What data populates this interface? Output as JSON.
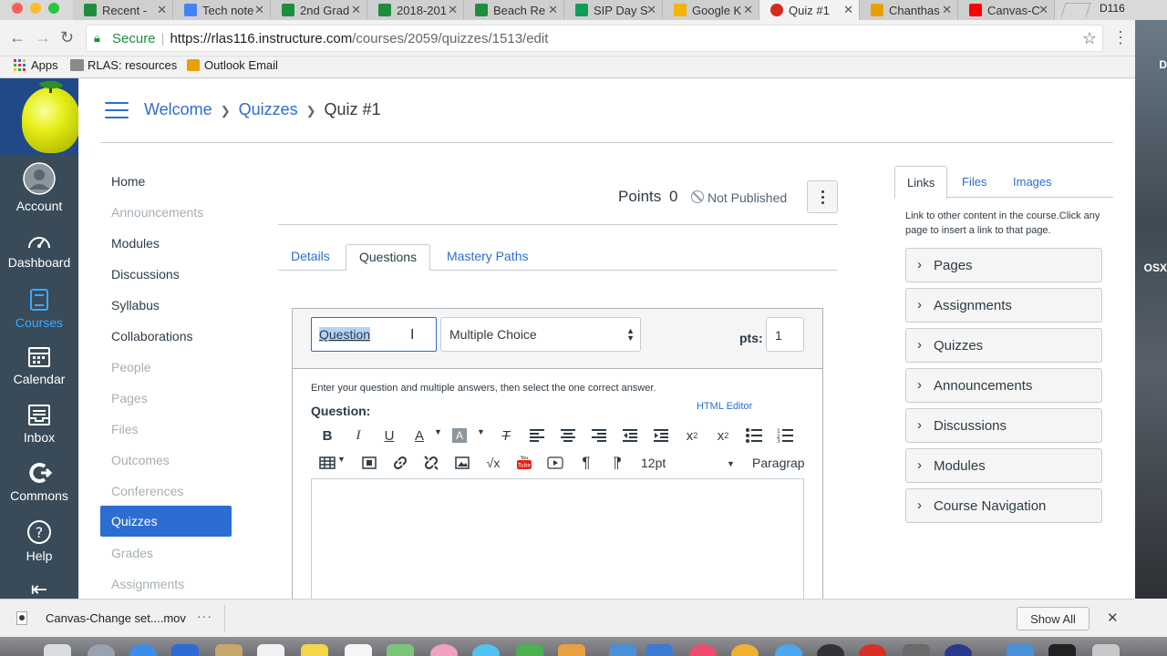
{
  "browser": {
    "tabs": [
      {
        "label": "Recent -",
        "favicon_color": "#1e8e3e",
        "icon": "drive-icon"
      },
      {
        "label": "Tech note",
        "favicon_color": "#4285f4",
        "icon": "docs-icon"
      },
      {
        "label": "2nd Grad",
        "favicon_color": "#1e8e3e",
        "icon": "drive-icon"
      },
      {
        "label": "2018-201",
        "favicon_color": "#1e8e3e",
        "icon": "drive-icon"
      },
      {
        "label": "Beach Re",
        "favicon_color": "#1e8e3e",
        "icon": "drive-icon"
      },
      {
        "label": "SIP Day S",
        "favicon_color": "#0f9d58",
        "icon": "sheets-icon"
      },
      {
        "label": "Google K",
        "favicon_color": "#f4b400",
        "icon": "keep-icon"
      },
      {
        "label": "Quiz #1",
        "favicon_color": "#d52b1e",
        "icon": "canvas-icon",
        "active": true
      },
      {
        "label": "Chanthas",
        "favicon_color": "#e8a000",
        "icon": "outlook-icon"
      },
      {
        "label": "Canvas-C",
        "favicon_color": "#ff0000",
        "icon": "youtube-icon"
      }
    ],
    "profile_label": "D116",
    "address": {
      "secure_label": "Secure",
      "host": "https://rlas116.instructure.com",
      "path": "/courses/2059/quizzes/1513/edit"
    },
    "bookmarks": [
      {
        "label": "Apps",
        "icon": "apps-grid-icon"
      },
      {
        "label": "RLAS: resources",
        "icon": "folder-icon"
      },
      {
        "label": "Outlook Email",
        "icon": "outlook-icon"
      }
    ]
  },
  "background_text": {
    "a": "D",
    "b": "OSX"
  },
  "global_nav": {
    "items": [
      {
        "label": "Account",
        "icon": "account-avatar-icon"
      },
      {
        "label": "Dashboard",
        "icon": "dashboard-icon"
      },
      {
        "label": "Courses",
        "icon": "courses-book-icon",
        "active": true
      },
      {
        "label": "Calendar",
        "icon": "calendar-icon"
      },
      {
        "label": "Inbox",
        "icon": "inbox-icon"
      },
      {
        "label": "Commons",
        "icon": "commons-icon"
      },
      {
        "label": "Help",
        "icon": "help-icon"
      }
    ],
    "collapse_icon": "collapse-nav-icon"
  },
  "breadcrumb": {
    "items": [
      "Welcome",
      "Quizzes"
    ],
    "current": "Quiz #1"
  },
  "course_nav": {
    "items": [
      {
        "label": "Home",
        "enabled": true
      },
      {
        "label": "Announcements",
        "enabled": false
      },
      {
        "label": "Modules",
        "enabled": true
      },
      {
        "label": "Discussions",
        "enabled": true
      },
      {
        "label": "Syllabus",
        "enabled": true
      },
      {
        "label": "Collaborations",
        "enabled": true
      },
      {
        "label": "People",
        "enabled": false
      },
      {
        "label": "Pages",
        "enabled": false
      },
      {
        "label": "Files",
        "enabled": false
      },
      {
        "label": "Outcomes",
        "enabled": false
      },
      {
        "label": "Conferences",
        "enabled": false
      },
      {
        "label": "Quizzes",
        "enabled": true,
        "active": true
      },
      {
        "label": "Grades",
        "enabled": false
      },
      {
        "label": "Assignments",
        "enabled": false
      }
    ]
  },
  "quiz_header": {
    "points_label": "Points",
    "points_value": "0",
    "status": "Not Published"
  },
  "quiz_tabs": [
    {
      "label": "Details"
    },
    {
      "label": "Questions",
      "active": true
    },
    {
      "label": "Mastery Paths"
    }
  ],
  "question": {
    "name_value": "Question",
    "type_value": "Multiple Choice",
    "pts_label": "pts:",
    "pts_value": "1",
    "instructions": "Enter your question and multiple answers, then select the one correct answer.",
    "question_label": "Question:",
    "html_editor_link": "HTML Editor",
    "font_size": "12pt",
    "block_format": "Paragrap"
  },
  "sidebar": {
    "tabs": [
      {
        "label": "Links",
        "active": true
      },
      {
        "label": "Files"
      },
      {
        "label": "Images"
      }
    ],
    "help_text": "Link to other content in the course.Click any page to insert a link to that page.",
    "accordions": [
      "Pages",
      "Assignments",
      "Quizzes",
      "Announcements",
      "Discussions",
      "Modules",
      "Course Navigation"
    ]
  },
  "download_shelf": {
    "filename": "Canvas-Change set....mov",
    "show_all": "Show All"
  },
  "colors": {
    "canvas_blue": "#2d6dd1",
    "nav_bg": "#394b58",
    "text": "#2d3b45",
    "disabled": "#a5afb5"
  }
}
